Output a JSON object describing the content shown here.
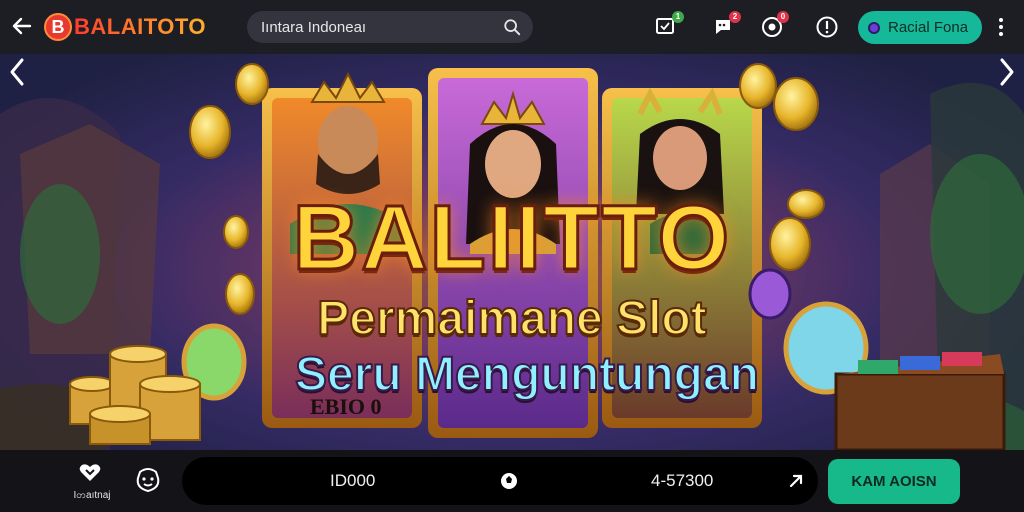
{
  "header": {
    "logo_text": "BALAITOTO",
    "logo_mark": "B",
    "search": {
      "value": "",
      "placeholder": "Iıntara Indoneaı",
      "icon": "search-icon"
    },
    "icons": [
      {
        "name": "monitor-icon",
        "badge": "1",
        "badge_color": "#3ea84a"
      },
      {
        "name": "chat-icon",
        "badge": "2",
        "badge_color": "#e0334a"
      },
      {
        "name": "casino-chip-icon",
        "badge": "0",
        "badge_color": "#e0334a"
      },
      {
        "name": "alert-icon"
      }
    ],
    "user_button": "Racial Fona",
    "user_color": "#16b89a",
    "menu_icon": "kebab-menu-icon"
  },
  "hero": {
    "title": "BALIITTO",
    "subtitle_line1": "Permaimane Slot",
    "subtitle_line2": "Seru Menguntungan",
    "card_tag": "EBIO 0",
    "prev_icon": "chevron-left-icon",
    "next_icon": "chevron-right-icon"
  },
  "footer": {
    "home_label": "Iတaıtnaj",
    "home_icon": "heart-home-icon",
    "face_icon": "smiley-face-icon",
    "pill_left": "ID000",
    "pill_mid_icon": "ball-icon",
    "pill_right": "4-57300",
    "pill_end_icon": "arrow-icon",
    "action_button": "KAM AOISN"
  },
  "colors": {
    "accent": "#16b89a",
    "topbar_bg": "#1d1d24",
    "logo_red": "#e8392f",
    "title_gold": "#ffd43a"
  }
}
